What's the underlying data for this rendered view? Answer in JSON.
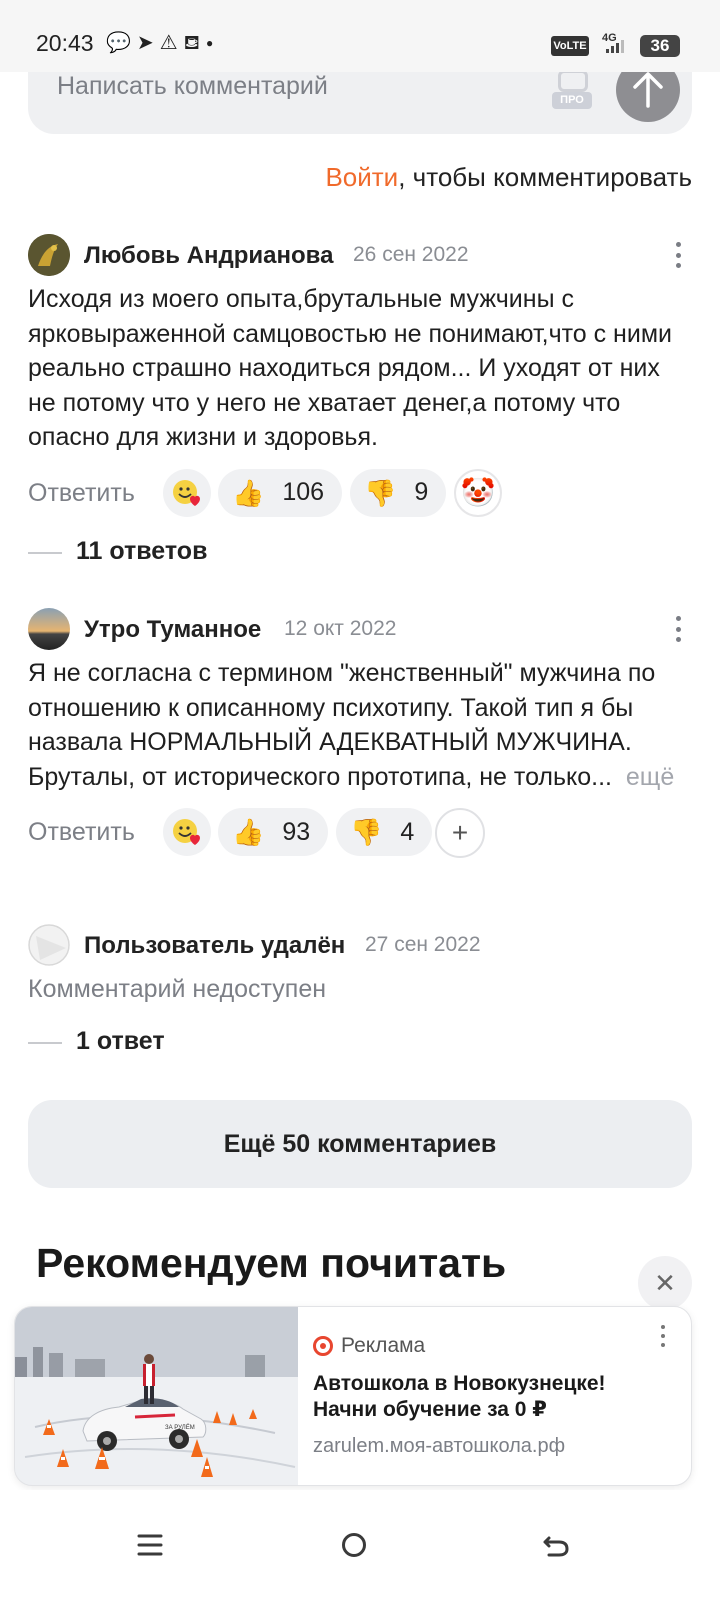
{
  "status_bar": {
    "time": "20:43",
    "volte": "VoLTE",
    "network": "4G",
    "battery": "36"
  },
  "comment_input": {
    "placeholder": "Написать комментарий",
    "photo_badge": "ПРО"
  },
  "login_prompt": {
    "link": "Войти",
    "text": ", чтобы комментировать"
  },
  "comments": [
    {
      "author": "Любовь Андрианова",
      "date": "26 сен 2022",
      "text": "Исходя из моего опыта,брутальные мужчины с ярковыраженной самцовостью не понимают,что с ними реально страшно находиться рядом... И уходят от них не потому что у него не хватает денег,а потому что опасно для жизни и здоровья.",
      "reply_label": "Ответить",
      "likes": "106",
      "dislikes": "9",
      "replies": "11 ответов"
    },
    {
      "author": "Утро Туманное",
      "date": "12 окт 2022",
      "text": "Я не согласна с термином \"женственный\" мужчина по отношению к описанному психотипу. Такой тип я бы назвала НОРМАЛЬНЫЙ АДЕКВАТНЫЙ МУЖЧИНА. Бруталы, от исторического прототипа, не только...",
      "more": "ещё",
      "reply_label": "Ответить",
      "likes": "93",
      "dislikes": "4"
    },
    {
      "author": "Пользователь удалён",
      "date": "27 сен 2022",
      "text": "Комментарий недоступен",
      "replies": "1 ответ"
    }
  ],
  "more_comments_label": "Ещё 50 комментариев",
  "recommend_title": "Рекомендуем почитать",
  "ad": {
    "label": "Реклама",
    "title": "Автошкола в Новокузнецке! Начни обучение за 0 ₽",
    "url": "zarulem.моя-автошкола.рф",
    "car_text": "ЗА РУЛЁМ"
  },
  "icons": {
    "reaction_add": "smiley-heart-icon",
    "like": "thumbs-up-icon",
    "dislike": "thumbs-down-icon",
    "clown": "clown-icon",
    "close": "close-icon",
    "nav": [
      "menu-icon",
      "home-icon",
      "back-icon"
    ]
  },
  "colors": {
    "accent": "#f06a2b",
    "input_bg": "#eff0f2",
    "send_button": "#8e8e92",
    "ad_mark": "#e8462f"
  }
}
